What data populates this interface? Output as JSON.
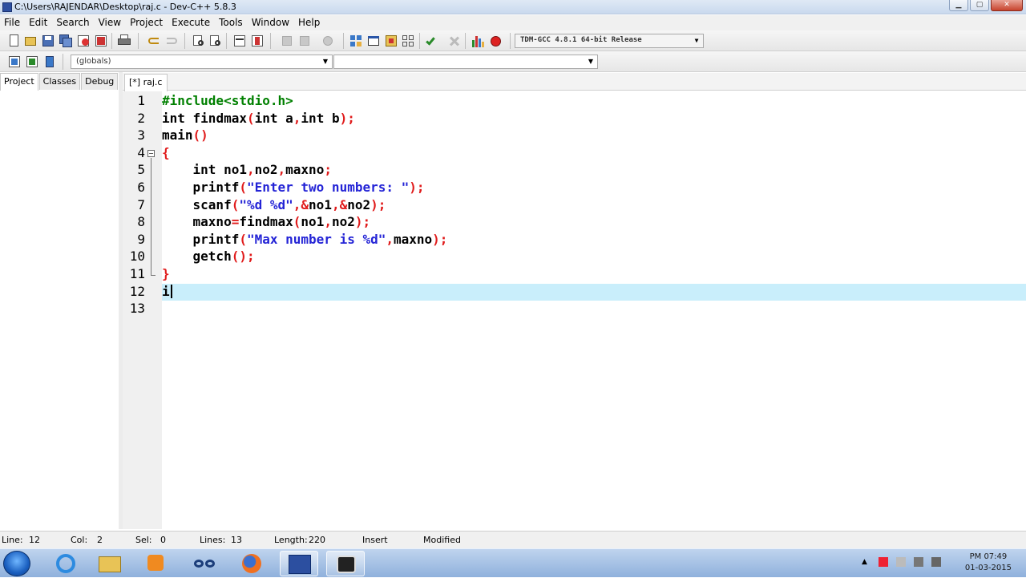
{
  "window": {
    "title": "C:\\Users\\RAJENDAR\\Desktop\\raj.c - Dev-C++ 5.8.3"
  },
  "menu": [
    "File",
    "Edit",
    "Search",
    "View",
    "Project",
    "Execute",
    "Tools",
    "Window",
    "Help"
  ],
  "toolbar": {
    "compiler": "TDM-GCC 4.8.1 64-bit Release",
    "scope": "(globals)",
    "symbol": ""
  },
  "left_tabs": [
    "Project",
    "Classes",
    "Debug"
  ],
  "editor_tab": "[*] raj.c",
  "code": {
    "lines": [
      [
        {
          "t": "#include<stdio.h>",
          "c": "pp"
        }
      ],
      [
        {
          "t": "int",
          "c": "kw"
        },
        {
          "t": " findmax",
          "c": "nm"
        },
        {
          "t": "(",
          "c": "sym"
        },
        {
          "t": "int",
          "c": "kw"
        },
        {
          "t": " a",
          "c": "nm"
        },
        {
          "t": ",",
          "c": "sym"
        },
        {
          "t": "int",
          "c": "kw"
        },
        {
          "t": " b",
          "c": "nm"
        },
        {
          "t": ");",
          "c": "sym"
        }
      ],
      [
        {
          "t": "main",
          "c": "nm"
        },
        {
          "t": "()",
          "c": "sym"
        }
      ],
      [
        {
          "t": "{",
          "c": "sym"
        }
      ],
      [
        {
          "t": "    int",
          "c": "kw"
        },
        {
          "t": " no1",
          "c": "nm"
        },
        {
          "t": ",",
          "c": "sym"
        },
        {
          "t": "no2",
          "c": "nm"
        },
        {
          "t": ",",
          "c": "sym"
        },
        {
          "t": "maxno",
          "c": "nm"
        },
        {
          "t": ";",
          "c": "sym"
        }
      ],
      [
        {
          "t": "    printf",
          "c": "nm"
        },
        {
          "t": "(",
          "c": "sym"
        },
        {
          "t": "\"Enter two numbers: \"",
          "c": "str"
        },
        {
          "t": ");",
          "c": "sym"
        }
      ],
      [
        {
          "t": "    scanf",
          "c": "nm"
        },
        {
          "t": "(",
          "c": "sym"
        },
        {
          "t": "\"%d %d\"",
          "c": "str"
        },
        {
          "t": ",&",
          "c": "sym"
        },
        {
          "t": "no1",
          "c": "nm"
        },
        {
          "t": ",&",
          "c": "sym"
        },
        {
          "t": "no2",
          "c": "nm"
        },
        {
          "t": ");",
          "c": "sym"
        }
      ],
      [
        {
          "t": "    maxno",
          "c": "nm"
        },
        {
          "t": "=",
          "c": "sym"
        },
        {
          "t": "findmax",
          "c": "nm"
        },
        {
          "t": "(",
          "c": "sym"
        },
        {
          "t": "no1",
          "c": "nm"
        },
        {
          "t": ",",
          "c": "sym"
        },
        {
          "t": "no2",
          "c": "nm"
        },
        {
          "t": ");",
          "c": "sym"
        }
      ],
      [
        {
          "t": "    printf",
          "c": "nm"
        },
        {
          "t": "(",
          "c": "sym"
        },
        {
          "t": "\"Max number is %d\"",
          "c": "str"
        },
        {
          "t": ",",
          "c": "sym"
        },
        {
          "t": "maxno",
          "c": "nm"
        },
        {
          "t": ");",
          "c": "sym"
        }
      ],
      [
        {
          "t": "    getch",
          "c": "nm"
        },
        {
          "t": "();",
          "c": "sym"
        }
      ],
      [
        {
          "t": "}",
          "c": "sym"
        }
      ],
      [
        {
          "t": "i",
          "c": "nm"
        }
      ],
      []
    ],
    "line_numbers": [
      "1",
      "2",
      "3",
      "4",
      "5",
      "6",
      "7",
      "8",
      "9",
      "10",
      "11",
      "12",
      "13"
    ]
  },
  "status": {
    "line_label": "Line:",
    "line": "12",
    "col_label": "Col:",
    "col": "2",
    "sel_label": "Sel:",
    "sel": "0",
    "lines_label": "Lines:",
    "lines": "13",
    "length_label": "Length:",
    "length": "220",
    "mode": "Insert",
    "state": "Modified"
  },
  "taskbar": {
    "time": "PM 07:49",
    "date": "01-03-2015"
  },
  "colors": {
    "current_line": "#c9eefb",
    "symbol": "#e01b1b",
    "string": "#2424d6",
    "preprocessor": "#008000"
  }
}
